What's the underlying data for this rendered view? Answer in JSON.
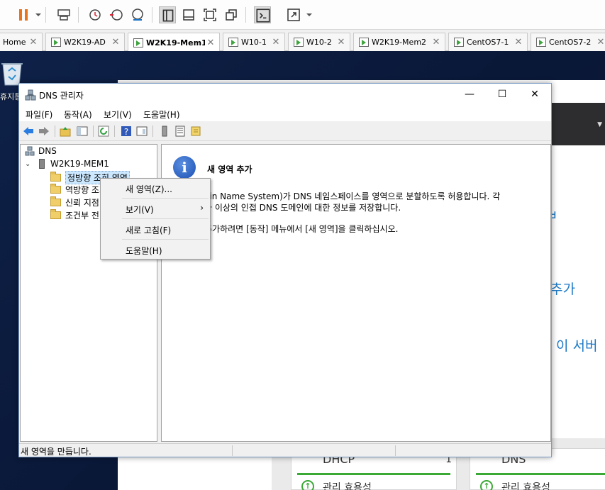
{
  "tabs": [
    {
      "label": "Home"
    },
    {
      "label": "W2K19-AD"
    },
    {
      "label": "W2K19-Mem1"
    },
    {
      "label": "W10-1"
    },
    {
      "label": "W10-2"
    },
    {
      "label": "W2K19-Mem2"
    },
    {
      "label": "CentOS7-1"
    },
    {
      "label": "CentOS7-2"
    }
  ],
  "desktop": {
    "recycle_label": "휴지통"
  },
  "dns_window": {
    "title": "DNS 관리자",
    "menu": [
      "파일(F)",
      "동작(A)",
      "보기(V)",
      "도움말(H)"
    ],
    "tree": {
      "root": "DNS",
      "server": "W2K19-MEM1",
      "zones": [
        "정방향 조회 영역",
        "역방향 조회 영역",
        "신뢰 지점",
        "조건부 전달자"
      ]
    },
    "content": {
      "heading": "새 영역 추가",
      "line1": "ain Name System)가 DNS 네임스페이스를 영역으로 분할하도록 허용합니다. 각",
      "line2": "나 이상의 인접 DNS 도메인에 대한 정보를 저장합니다.",
      "line3": "추가하려면 [동작] 메뉴에서 [새 영역]을 클릭하십시오."
    },
    "status": "새 영역을 만듭니다."
  },
  "context_menu": {
    "items": [
      "새 영역(Z)...",
      "보기(V)",
      "새로 고침(F)",
      "도움말(H)"
    ]
  },
  "server_manager": {
    "text1": "ㅂ",
    "text2": "추가",
    "text3": "이 서버",
    "tile_dhcp": {
      "title": "DHCP",
      "count": "1",
      "status": "관리 효용성"
    },
    "tile_dns": {
      "title": "DNS",
      "status": "관리 효용성"
    }
  },
  "colors": {
    "accent": "#1d79c5",
    "status_ok": "#3aa935",
    "title_blue": "#7a9cc7"
  }
}
